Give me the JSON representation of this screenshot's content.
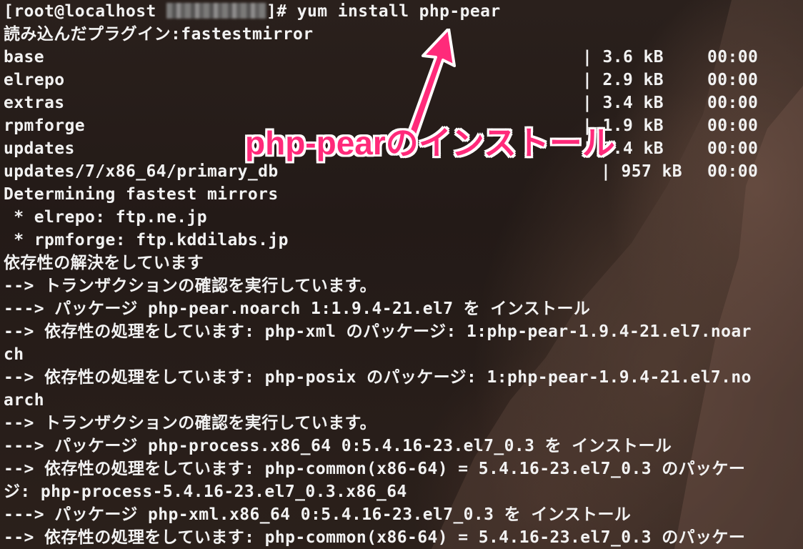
{
  "prompt": {
    "user": "[root@localhost ",
    "host_masked": "",
    "close": "]# ",
    "command": "yum install php-pear"
  },
  "lines": {
    "l1": "読み込んだプラグイン:fastestmirror",
    "l8": "Determining fastest mirrors",
    "l9": " * elrepo: ftp.ne.jp",
    "l10": " * rpmforge: ftp.kddilabs.jp",
    "l11": "依存性の解決をしています",
    "l12": "--> トランザクションの確認を実行しています。",
    "l13": "---> パッケージ php-pear.noarch 1:1.9.4-21.el7 を インストール",
    "l14": "--> 依存性の処理をしています: php-xml のパッケージ: 1:php-pear-1.9.4-21.el7.noar",
    "l15": "ch",
    "l16": "--> 依存性の処理をしています: php-posix のパッケージ: 1:php-pear-1.9.4-21.el7.no",
    "l17": "arch",
    "l18": "--> トランザクションの確認を実行しています。",
    "l19": "---> パッケージ php-process.x86_64 0:5.4.16-23.el7_0.3 を インストール",
    "l20": "--> 依存性の処理をしています: php-common(x86-64) = 5.4.16-23.el7_0.3 のパッケー",
    "l21": "ジ: php-process-5.4.16-23.el7_0.3.x86_64",
    "l22": "---> パッケージ php-xml.x86_64 0:5.4.16-23.el7_0.3 を インストール",
    "l23": "--> 依存性の処理をしています: php-common(x86-64) = 5.4.16-23.el7_0.3 のパッケー"
  },
  "repos": [
    {
      "name": "base",
      "size": "| 3.6 kB",
      "time": "00:00"
    },
    {
      "name": "elrepo",
      "size": "| 2.9 kB",
      "time": "00:00"
    },
    {
      "name": "extras",
      "size": "| 3.4 kB",
      "time": "00:00"
    },
    {
      "name": "rpmforge",
      "size": "| 1.9 kB",
      "time": "00:00"
    },
    {
      "name": "updates",
      "size": "| 3.4 kB",
      "time": "00:00"
    },
    {
      "name": "updates/7/x86_64/primary_db",
      "size": "| 957 kB",
      "time": "00:00"
    }
  ],
  "annotation": {
    "text": "php-pearのインストール",
    "color": "#ff2a7a"
  },
  "colors": {
    "text": "#f2f2f2",
    "background": "#231a17"
  }
}
